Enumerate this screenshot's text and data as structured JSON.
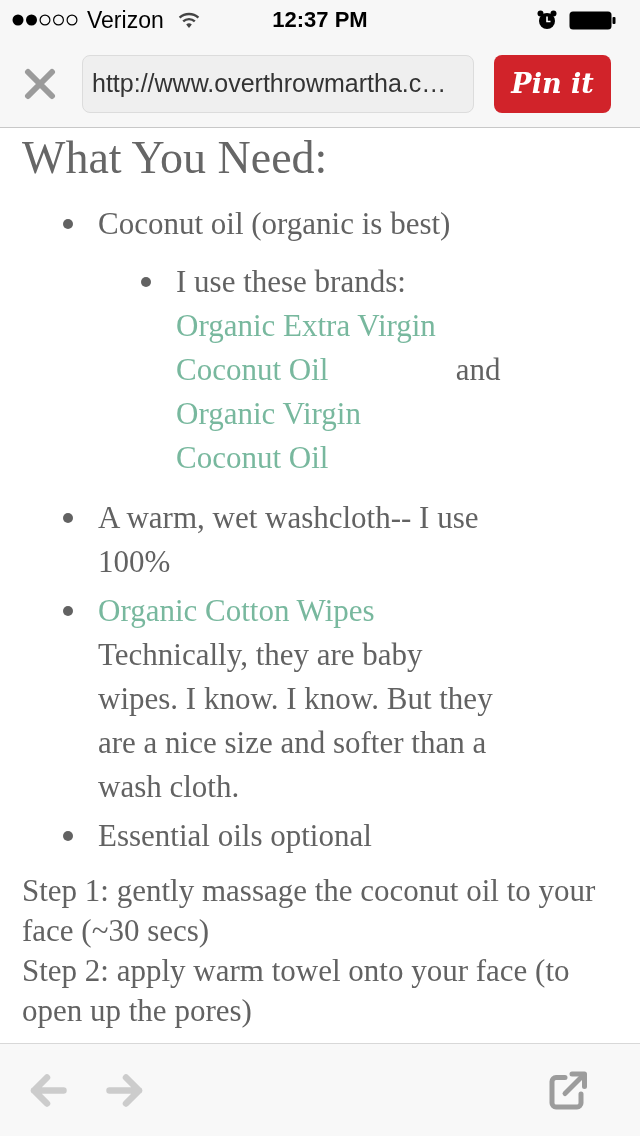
{
  "status_bar": {
    "carrier": "Verizon",
    "time": "12:37 PM"
  },
  "toolbar": {
    "url": "http://www.overthrowmartha.c…",
    "pin_button": "Pin it"
  },
  "article": {
    "heading": "What You Need:",
    "items": [
      {
        "parts": [
          {
            "kind": "text",
            "text": "Coconut oil (organic is best)"
          }
        ],
        "children": [
          {
            "parts": [
              {
                "kind": "text",
                "text": "I use these brands:"
              },
              {
                "kind": "link",
                "text": "Organic Extra Virgin Coconut Oil"
              },
              {
                "kind": "text",
                "text": "and"
              },
              {
                "kind": "link",
                "text": "Organic Virgin Coconut Oil"
              }
            ]
          }
        ]
      },
      {
        "parts": [
          {
            "kind": "text",
            "text": "A warm, wet washcloth-- I use 100%"
          }
        ]
      },
      {
        "parts": [
          {
            "kind": "link",
            "text": "Organic Cotton Wipes"
          },
          {
            "kind": "text",
            "text": "Technically, they are baby wipes. I know. I know. But they are a nice size and softer than a wash cloth."
          }
        ]
      },
      {
        "parts": [
          {
            "kind": "text",
            "text": "Essential oils optional"
          }
        ]
      }
    ],
    "steps": [
      "Step 1: gently massage the coconut oil to your face (~30 secs)",
      "Step 2: apply warm towel onto your face (to open up the pores)"
    ]
  },
  "bottom_toolbar": {
    "back": {
      "disabled": true
    },
    "forward": {
      "disabled": true
    }
  }
}
